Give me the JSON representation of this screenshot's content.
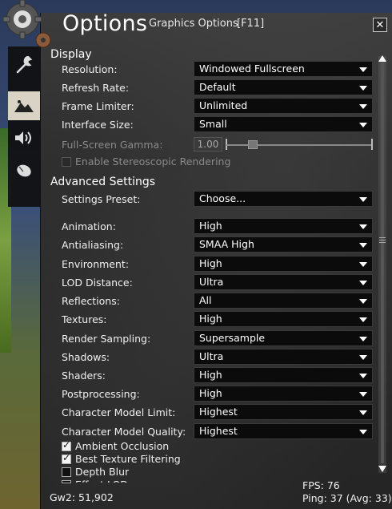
{
  "header": {
    "title": "Options",
    "subtitle": "Graphics Options",
    "hotkey": "[F11]",
    "close_label": "✕"
  },
  "sidebar": {
    "tabs": [
      {
        "icon": "wrench-icon",
        "active": false
      },
      {
        "icon": "mountain-icon",
        "active": true
      },
      {
        "icon": "speaker-icon",
        "active": false
      },
      {
        "icon": "mouse-icon",
        "active": false
      }
    ]
  },
  "display": {
    "heading": "Display",
    "resolution": {
      "label": "Resolution:",
      "value": "Windowed Fullscreen"
    },
    "refresh_rate": {
      "label": "Refresh Rate:",
      "value": "Default"
    },
    "frame_limiter": {
      "label": "Frame Limiter:",
      "value": "Unlimited"
    },
    "interface_size": {
      "label": "Interface Size:",
      "value": "Small"
    },
    "gamma": {
      "label": "Full-Screen Gamma:",
      "value": "1.00"
    },
    "stereo": {
      "label": "Enable Stereoscopic Rendering",
      "checked": false
    }
  },
  "advanced": {
    "heading": "Advanced Settings",
    "preset": {
      "label": "Settings Preset:",
      "value": "Choose..."
    },
    "rows": [
      {
        "label": "Animation:",
        "value": "High"
      },
      {
        "label": "Antialiasing:",
        "value": "SMAA High"
      },
      {
        "label": "Environment:",
        "value": "High"
      },
      {
        "label": "LOD Distance:",
        "value": "Ultra"
      },
      {
        "label": "Reflections:",
        "value": "All"
      },
      {
        "label": "Textures:",
        "value": "High"
      },
      {
        "label": "Render Sampling:",
        "value": "Supersample"
      },
      {
        "label": "Shadows:",
        "value": "Ultra"
      },
      {
        "label": "Shaders:",
        "value": "High"
      },
      {
        "label": "Postprocessing:",
        "value": "High"
      },
      {
        "label": "Character Model Limit:",
        "value": "Highest"
      },
      {
        "label": "Character Model Quality:",
        "value": "Highest"
      }
    ],
    "checkboxes": [
      {
        "label": "Ambient Occlusion",
        "checked": true
      },
      {
        "label": "Best Texture Filtering",
        "checked": true
      },
      {
        "label": "Depth Blur",
        "checked": false
      },
      {
        "label": "Effect LOD",
        "checked": false
      }
    ]
  },
  "footer": {
    "currency": "Gw2: 51,902",
    "fps": "FPS: 76",
    "ping": "Ping: 37 (Avg: 33)"
  }
}
